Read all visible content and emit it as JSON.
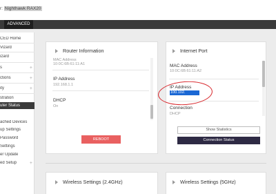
{
  "header": {
    "router_label_prefix": "r: ",
    "router_name": "Nighthawk RAX20"
  },
  "nav": {
    "advanced_tab": "ADVANCED"
  },
  "sidebar": {
    "items": [
      {
        "label": "CED Home"
      },
      {
        "label": "Vizard"
      },
      {
        "label": "izard"
      },
      {
        "label": "s"
      },
      {
        "label": "ctions"
      },
      {
        "label": "ity"
      },
      {
        "label": "stration"
      },
      {
        "label": "uter Status"
      },
      {
        "label": "ached Devices"
      },
      {
        "label": "up Settings"
      },
      {
        "label": "Password"
      },
      {
        "label": "Settings"
      },
      {
        "label": "er Update"
      },
      {
        "label": "ed Setup"
      }
    ]
  },
  "router_info": {
    "title": "Router Information",
    "mac_label_partial": "MAC Address",
    "mac_value": "10:0C:6B:61:11:A1",
    "ip_label": "IP Address",
    "ip_value": "192.168.1.1",
    "dhcp_label": "DHCP",
    "dhcp_value": "On",
    "reboot_label": "REBOOT"
  },
  "internet_port": {
    "title": "Internet Port",
    "mac_label": "MAC Address",
    "mac_value": "10:0C:6B:61:11:A2",
    "ip_label": "IP Address",
    "ip_value": "100.102.",
    "connection_label": "Connection",
    "connection_value": "DHCP",
    "show_stats_label": "Show Statistics",
    "conn_status_label": "Connection Status"
  },
  "wireless": {
    "title_24": "Wireless Settings (2.4GHz)",
    "title_5": "Wireless Settings (5GHz)"
  }
}
